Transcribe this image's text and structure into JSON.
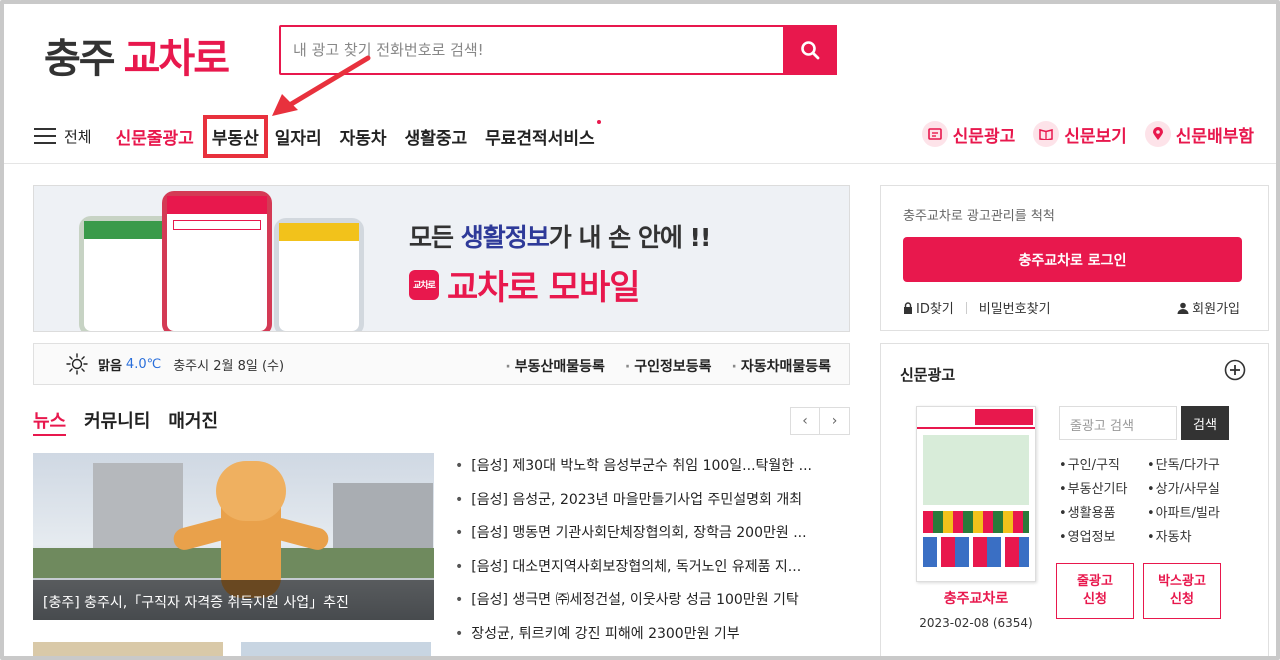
{
  "header": {
    "logo_part1": "충주",
    "logo_part2": "교차로",
    "search_placeholder": "내 광고 찾기 전화번호로 검색!"
  },
  "nav": {
    "all_label": "전체",
    "items": [
      "신문줄광고",
      "부동산",
      "일자리",
      "자동차",
      "생활중고",
      "무료견적서비스"
    ],
    "right_links": [
      "신문광고",
      "신문보기",
      "신문배부함"
    ]
  },
  "banner": {
    "line1_prefix": "모든 ",
    "line1_highlight": "생활정보",
    "line1_suffix": "가 내 손 안에 !!",
    "line2": "교차로 모바일",
    "badge": "교차로"
  },
  "weather": {
    "condition": "맑음",
    "temperature": "4.0℃",
    "date": "충주시 2월 8일 (수)",
    "quick_links": [
      "부동산매물등록",
      "구인정보등록",
      "자동차매물등록"
    ]
  },
  "tabs": [
    "뉴스",
    "커뮤니티",
    "매거진"
  ],
  "news": {
    "photo_caption": "[충주] 충주시,「구직자 자격증 취득지원 사업」추진",
    "items": [
      "[음성] 제30대 박노학 음성부군수 취임 100일...탁월한 ...",
      "[음성] 음성군, 2023년 마을만들기사업 주민설명회 개최",
      "[음성] 맹동면 기관사회단체장협의회, 장학금 200만원 ...",
      "[음성] 대소면지역사회보장협의체, 독거노인 유제품 지...",
      "[음성] 생극면 ㈜세정건설, 이웃사랑 성금 100만원 기탁",
      "장성균, 튀르키예 강진 피해에 2300만원 기부"
    ]
  },
  "login": {
    "message": "충주교차로 광고관리를 척척",
    "button": "충주교차로 로그인",
    "find_id": "ID찾기",
    "find_pw": "비밀번호찾기",
    "signup": "회원가입"
  },
  "paper": {
    "title": "신문광고",
    "name": "충주교차로",
    "date": "2023-02-08 (6354)",
    "search_placeholder": "줄광고 검색",
    "search_button": "검색",
    "categories": [
      "구인/구직",
      "단독/다가구",
      "부동산기타",
      "상가/사무실",
      "생활용품",
      "아파트/빌라",
      "영업정보",
      "자동차"
    ],
    "apply_line": "줄광고\n신청",
    "apply_box": "박스광고\n신청"
  },
  "colors": {
    "accent": "#e8184d",
    "annotation": "#e8313d"
  }
}
